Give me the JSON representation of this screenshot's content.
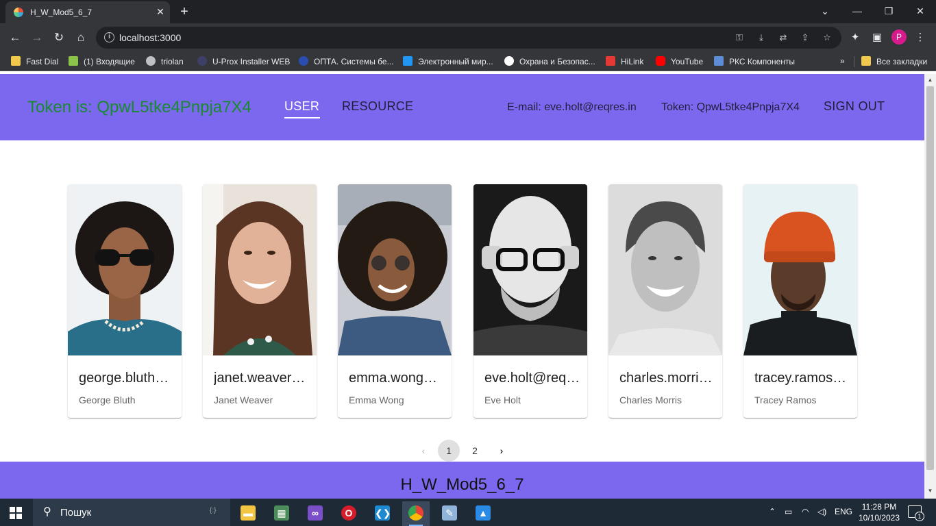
{
  "browser": {
    "tab_title": "H_W_Mod5_6_7",
    "url": "localhost:3000",
    "profile_initial": "P",
    "bookmarks": [
      {
        "label": "Fast Dial",
        "icon": "folder-icon",
        "color": "#f2c94c"
      },
      {
        "label": "(1) Входящие",
        "icon": "mail-icon",
        "color": "#8bc34a"
      },
      {
        "label": "triolan",
        "icon": "globe-icon",
        "color": "#bdc1c6"
      },
      {
        "label": "U-Prox Installer WEB",
        "icon": "globe-icon",
        "color": "#3d3f66"
      },
      {
        "label": "ОПТА. Системы бе...",
        "icon": "globe-icon",
        "color": "#2b4db0"
      },
      {
        "label": "Электронный мир...",
        "icon": "e-icon",
        "color": "#2196f3"
      },
      {
        "label": "Охрана и Безопас...",
        "icon": "eye-icon",
        "color": "#ffffff"
      },
      {
        "label": "HiLink",
        "icon": "huawei-icon",
        "color": "#e53935"
      },
      {
        "label": "YouTube",
        "icon": "youtube-icon",
        "color": "#ff0000"
      },
      {
        "label": "РКС Компоненты",
        "icon": "signal-icon",
        "color": "#5c8dd6"
      }
    ],
    "all_bookmarks_label": "Все закладки"
  },
  "header": {
    "token_heading": "Token is: QpwL5tke4Pnpja7X4",
    "tabs": [
      {
        "label": "USER",
        "active": true
      },
      {
        "label": "RESOURCE",
        "active": false
      }
    ],
    "email": "E-mail: eve.holt@reqres.in",
    "token": "Token: QpwL5tke4Pnpja7X4",
    "sign_out": "SIGN OUT",
    "accent_color": "#7b68ee",
    "token_color": "#1a8a2f"
  },
  "users": [
    {
      "email": "george.bluth@reqres.in",
      "name": "George Bluth"
    },
    {
      "email": "janet.weaver@reqres.in",
      "name": "Janet Weaver"
    },
    {
      "email": "emma.wong@reqres.in",
      "name": "Emma Wong"
    },
    {
      "email": "eve.holt@reqres.in",
      "name": "Eve Holt"
    },
    {
      "email": "charles.morris@reqres.in",
      "name": "Charles Morris"
    },
    {
      "email": "tracey.ramos@reqres.in",
      "name": "Tracey Ramos"
    }
  ],
  "pagination": {
    "pages": [
      "1",
      "2"
    ],
    "current": "1"
  },
  "footer": {
    "title": "H_W_Mod5_6_7"
  },
  "taskbar": {
    "search_placeholder": "Пошук",
    "language": "ENG",
    "time": "11:28 PM",
    "date": "10/10/2023",
    "notification_count": "1"
  }
}
